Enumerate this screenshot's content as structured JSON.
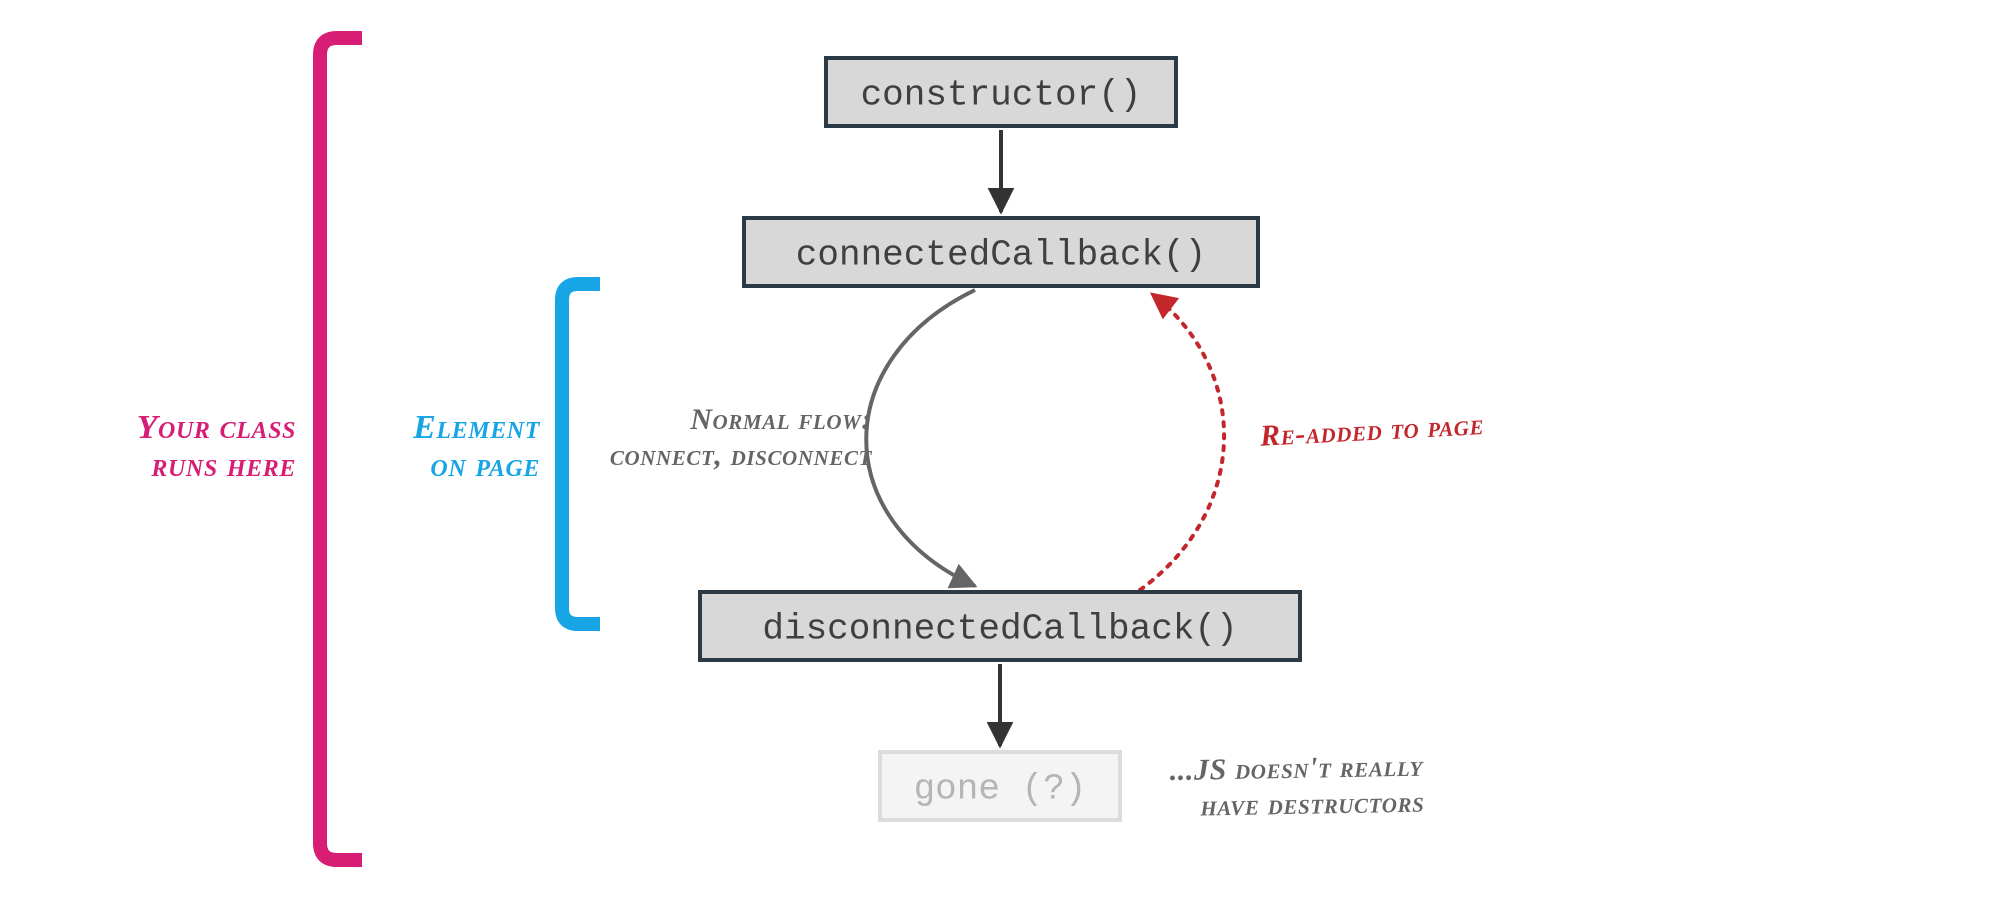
{
  "nodes": {
    "constructor": "constructor()",
    "connected": "connectedCallback()",
    "disconnected": "disconnectedCallback()",
    "gone": "gone (?)"
  },
  "annotations": {
    "class_runs_l1": "Your class",
    "class_runs_l2": "runs here",
    "on_page_l1": "Element",
    "on_page_l2": "on page",
    "normal_flow_l1": "Normal flow:",
    "normal_flow_l2": "connect, disconnect",
    "readded": "Re-added to page",
    "destructors_l1": "...JS doesn't really",
    "destructors_l2": "have destructors"
  },
  "colors": {
    "magenta": "#d81e74",
    "cyan": "#17a5e6",
    "red": "#c3272b",
    "grey": "#656565",
    "arrow": "#333333"
  }
}
